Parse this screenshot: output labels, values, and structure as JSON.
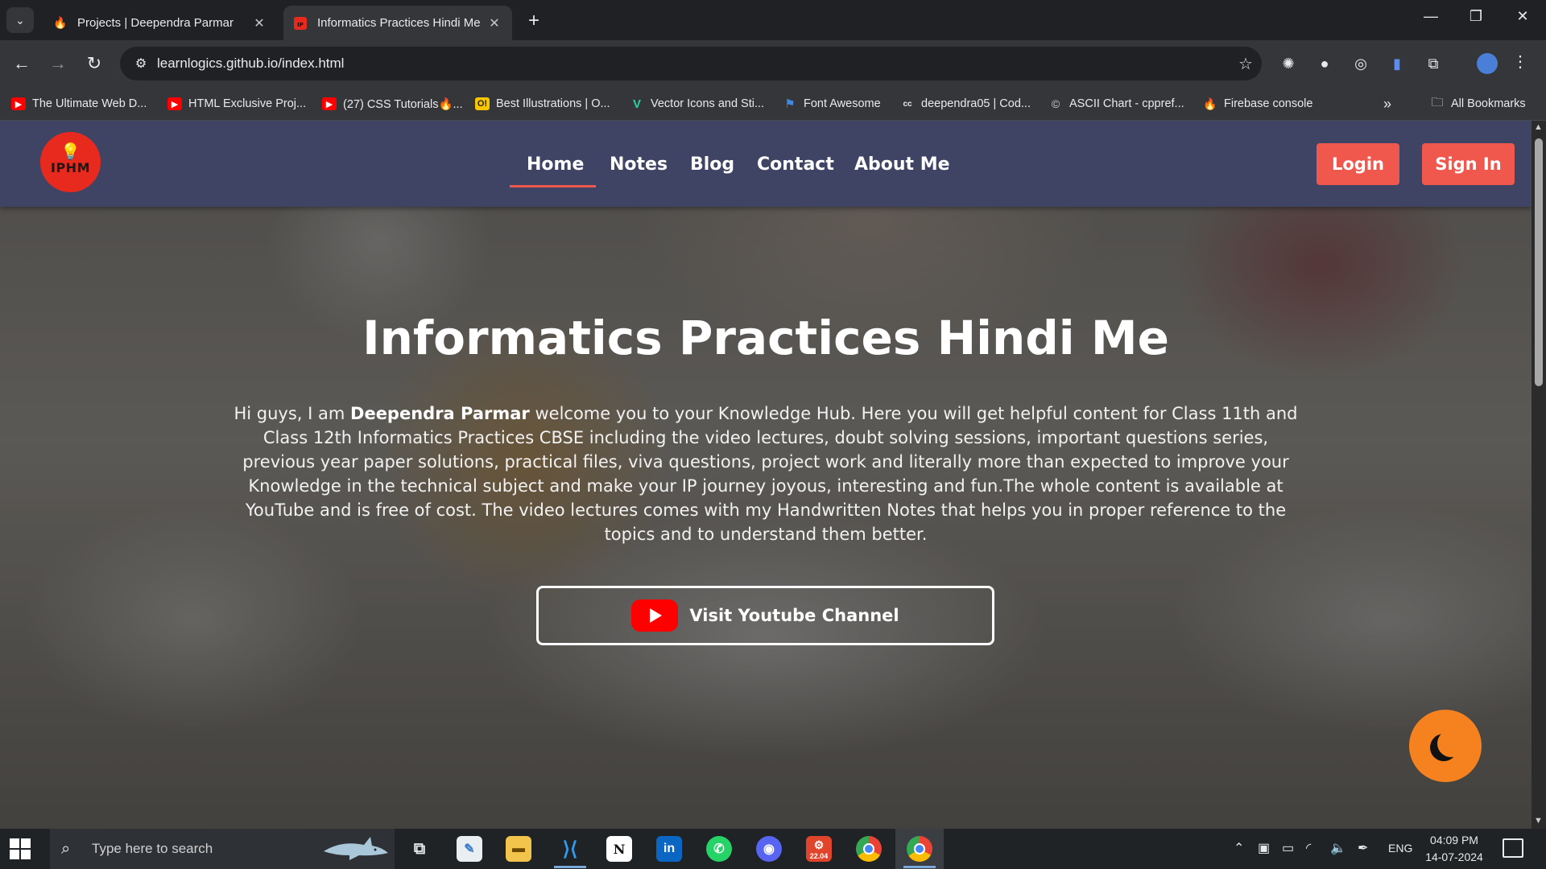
{
  "browser": {
    "tabs": [
      {
        "title": "Projects | Deependra Parmar",
        "active": false
      },
      {
        "title": "Informatics Practices Hindi Me",
        "active": true
      }
    ],
    "url": "learnlogics.github.io/index.html",
    "bookmarks": [
      {
        "label": "The Ultimate Web D..."
      },
      {
        "label": "HTML Exclusive Proj..."
      },
      {
        "label": "(27) CSS Tutorials🔥..."
      },
      {
        "label": "Best Illustrations | O..."
      },
      {
        "label": "Vector Icons and Sti..."
      },
      {
        "label": "Font Awesome"
      },
      {
        "label": "deependra05 | Cod..."
      },
      {
        "label": "ASCII Chart - cppref..."
      },
      {
        "label": "Firebase console"
      }
    ],
    "all_bookmarks": "All Bookmarks"
  },
  "site": {
    "logo_text": "IPHM",
    "nav": [
      {
        "label": "Home",
        "active": true
      },
      {
        "label": "Notes"
      },
      {
        "label": "Blog"
      },
      {
        "label": "Contact"
      },
      {
        "label": "About Me"
      }
    ],
    "login_label": "Login",
    "signin_label": "Sign In",
    "hero": {
      "title": "Informatics Practices Hindi Me",
      "intro_prefix": "Hi guys, I am ",
      "author": "Deependra Parmar",
      "intro_body": " welcome you to your Knowledge Hub. Here you will get helpful content for Class 11th and Class 12th Informatics Practices CBSE including the video lectures, doubt solving sessions, important questions series, previous year paper solutions, practical files, viva questions, project work and literally more than expected to improve your Knowledge in the technical subject and make your IP journey joyous, interesting and fun.The whole content is available at YouTube and is free of cost. The video lectures comes with my Handwritten Notes that helps you in proper reference to the topics and to understand them better.",
      "cta_label": "Visit Youtube Channel"
    },
    "accent_color": "#f0584e",
    "navbar_color": "#3f4464"
  },
  "taskbar": {
    "search_placeholder": "Type here to search",
    "app_badge": "22.04",
    "language": "ENG",
    "time": "04:09 PM",
    "date": "14-07-2024"
  }
}
